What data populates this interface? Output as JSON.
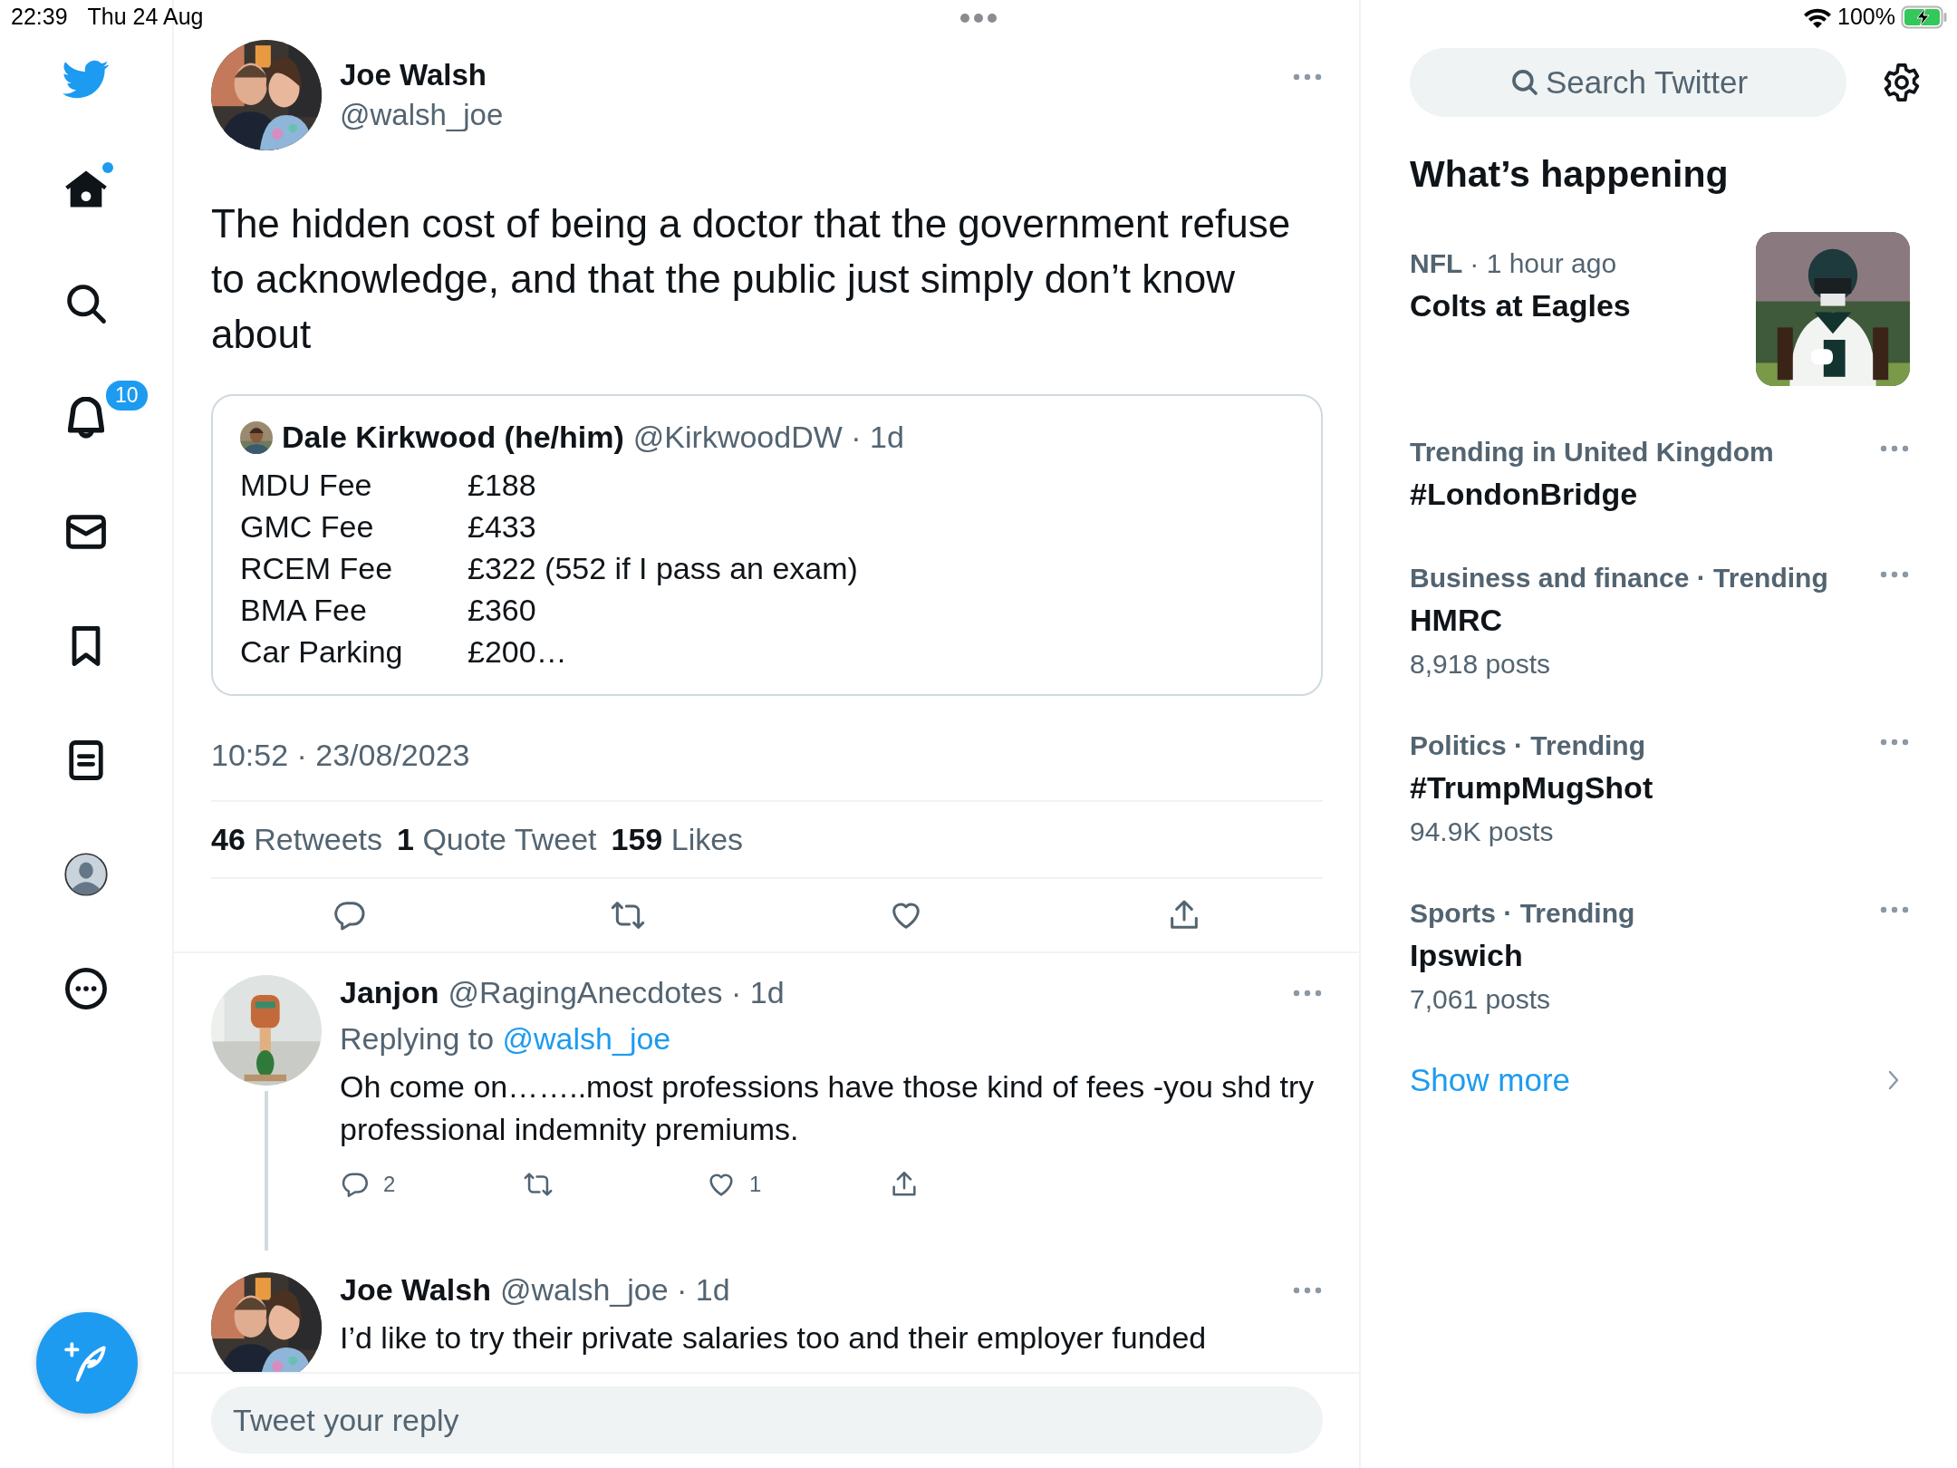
{
  "status_bar": {
    "time": "22:39",
    "date": "Thu 24 Aug",
    "battery": "100%"
  },
  "nav": {
    "home_unread": true,
    "notifications_badge": "10"
  },
  "tweet": {
    "author": "Joe Walsh",
    "handle": "@walsh_joe",
    "text": "The hidden cost of being a doctor that the government refuse to acknowledge, and that the public just simply don’t know about",
    "quote": {
      "author": "Dale Kirkwood (he/him)",
      "handle": "@KirkwoodDW · 1d",
      "rows": [
        {
          "label": "MDU Fee",
          "value": "£188"
        },
        {
          "label": "GMC Fee",
          "value": "£433"
        },
        {
          "label": "RCEM Fee",
          "value": "£322 (552 if I pass an exam)"
        },
        {
          "label": "BMA Fee",
          "value": "£360"
        },
        {
          "label": "Car Parking",
          "value": "£200…"
        }
      ]
    },
    "timestamp": "10:52 · 23/08/2023",
    "stats": [
      "**46** Retweets",
      "**1** Quote Tweet",
      "**159** Likes"
    ]
  },
  "replies": [
    {
      "author": "Janjon",
      "handle": "@RagingAnecdotes · 1d",
      "replying_label": "Replying to",
      "replying_to": "@walsh_joe",
      "text": "Oh come on……..most professions have those kind of fees -you shd try professional indemnity premiums.",
      "thread_line": true,
      "actions": [
        {
          "kind": "reply",
          "count": "2"
        },
        {
          "kind": "retweet"
        },
        {
          "kind": "like",
          "count": "1"
        },
        {
          "kind": "share"
        }
      ]
    },
    {
      "author": "Joe Walsh",
      "handle": "@walsh_joe · 1d",
      "text": "I’d like to try their private salaries too and their employer funded",
      "thread_line": false
    }
  ],
  "reply_box": {
    "placeholder": "Tweet your reply"
  },
  "search": {
    "placeholder": "Search Twitter"
  },
  "trends": {
    "title": "What’s happening",
    "items": [
      {
        "kind": "event",
        "category": "NFL",
        "meta": "· 1 hour ago",
        "title": "Colts at Eagles"
      },
      {
        "kind": "trend",
        "context": "Trending in United Kingdom",
        "title": "#LondonBridge"
      },
      {
        "kind": "trend",
        "context": "Business and finance · Trending",
        "title": "HMRC",
        "posts": "8,918 posts"
      },
      {
        "kind": "trend",
        "context": "Politics · Trending",
        "title": "#TrumpMugShot",
        "posts": "94.9K posts"
      },
      {
        "kind": "trend",
        "context": "Sports · Trending",
        "title": "Ipswich",
        "posts": "7,061 posts"
      }
    ],
    "show_more": "Show more"
  }
}
